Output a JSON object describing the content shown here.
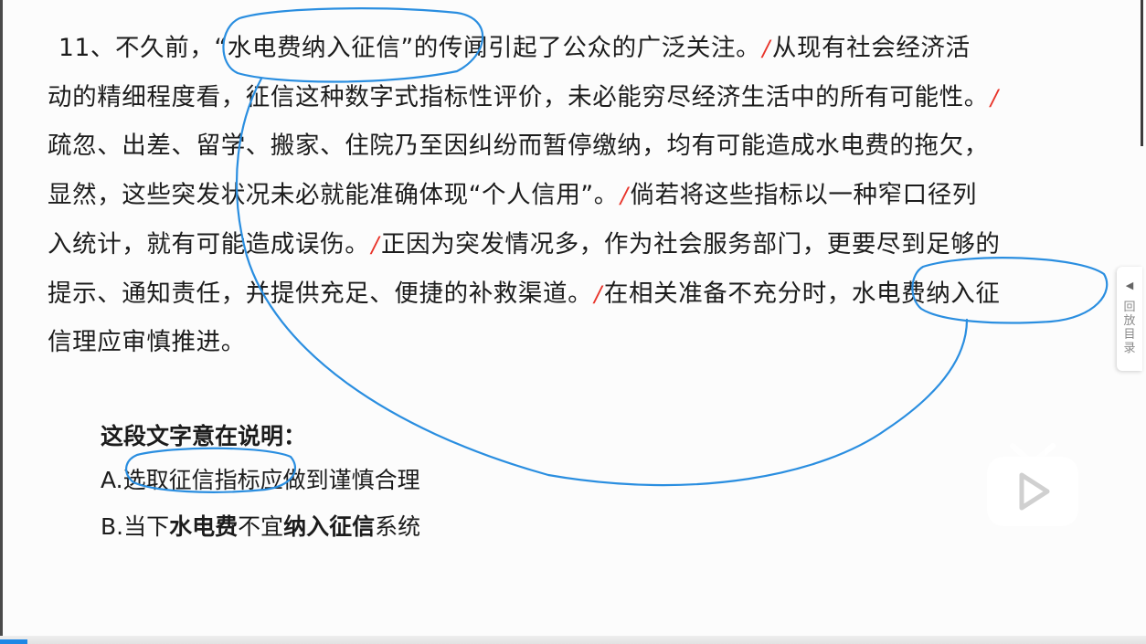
{
  "passage": {
    "lines": [
      {
        "parts": [
          "11、不久前，“水电费纳入征信”的传闻引起了公众的广泛关注。",
          "/",
          "从现有社会经济活"
        ]
      },
      {
        "parts": [
          "动的精细程度看，征信这种数字式指标性评价，未必能穷尽经济生活中的所有可能性。",
          "/"
        ]
      },
      {
        "parts": [
          "疏忽、出差、留学、搬家、住院乃至因纠纷而暂停缴纳，均有可能造成水电费的拖欠，"
        ]
      },
      {
        "parts": [
          "显然，这些突发状况未必就能准确体现“个人信用”。",
          "/",
          "倘若将这些指标以一种窄口径列"
        ]
      },
      {
        "parts": [
          "入统计，就有可能造成误伤。",
          "/",
          "正因为突发情况多，作为社会服务部门，更要尽到足够的"
        ]
      },
      {
        "parts": [
          "提示、通知责任，并提供充足、便捷的补救渠道。",
          "/",
          "在相关准备不充分时，水电费纳入征"
        ]
      },
      {
        "parts": [
          "信理应审慎推进。"
        ]
      }
    ]
  },
  "question": {
    "prompt": "这段文字意在说明：",
    "options": [
      {
        "letter": "A.",
        "segments": [
          {
            "text": "选取征信指标应做到谨慎合理",
            "bold": false
          }
        ]
      },
      {
        "letter": "B.",
        "segments": [
          {
            "text": "当下",
            "bold": false
          },
          {
            "text": "水电费",
            "bold": true
          },
          {
            "text": "不宜",
            "bold": false
          },
          {
            "text": "纳入征信",
            "bold": true
          },
          {
            "text": "系统",
            "bold": false
          }
        ]
      }
    ]
  },
  "side_panel": {
    "arrow": "◀",
    "label": "回放目录"
  },
  "colors": {
    "annotation_blue": "#2a8ee0",
    "slash_red": "#e8342a",
    "text": "#1c1c1c",
    "play_button": "#ffffff"
  },
  "icons": {
    "play": "play-icon",
    "side_arrow": "chevron-left-icon"
  }
}
